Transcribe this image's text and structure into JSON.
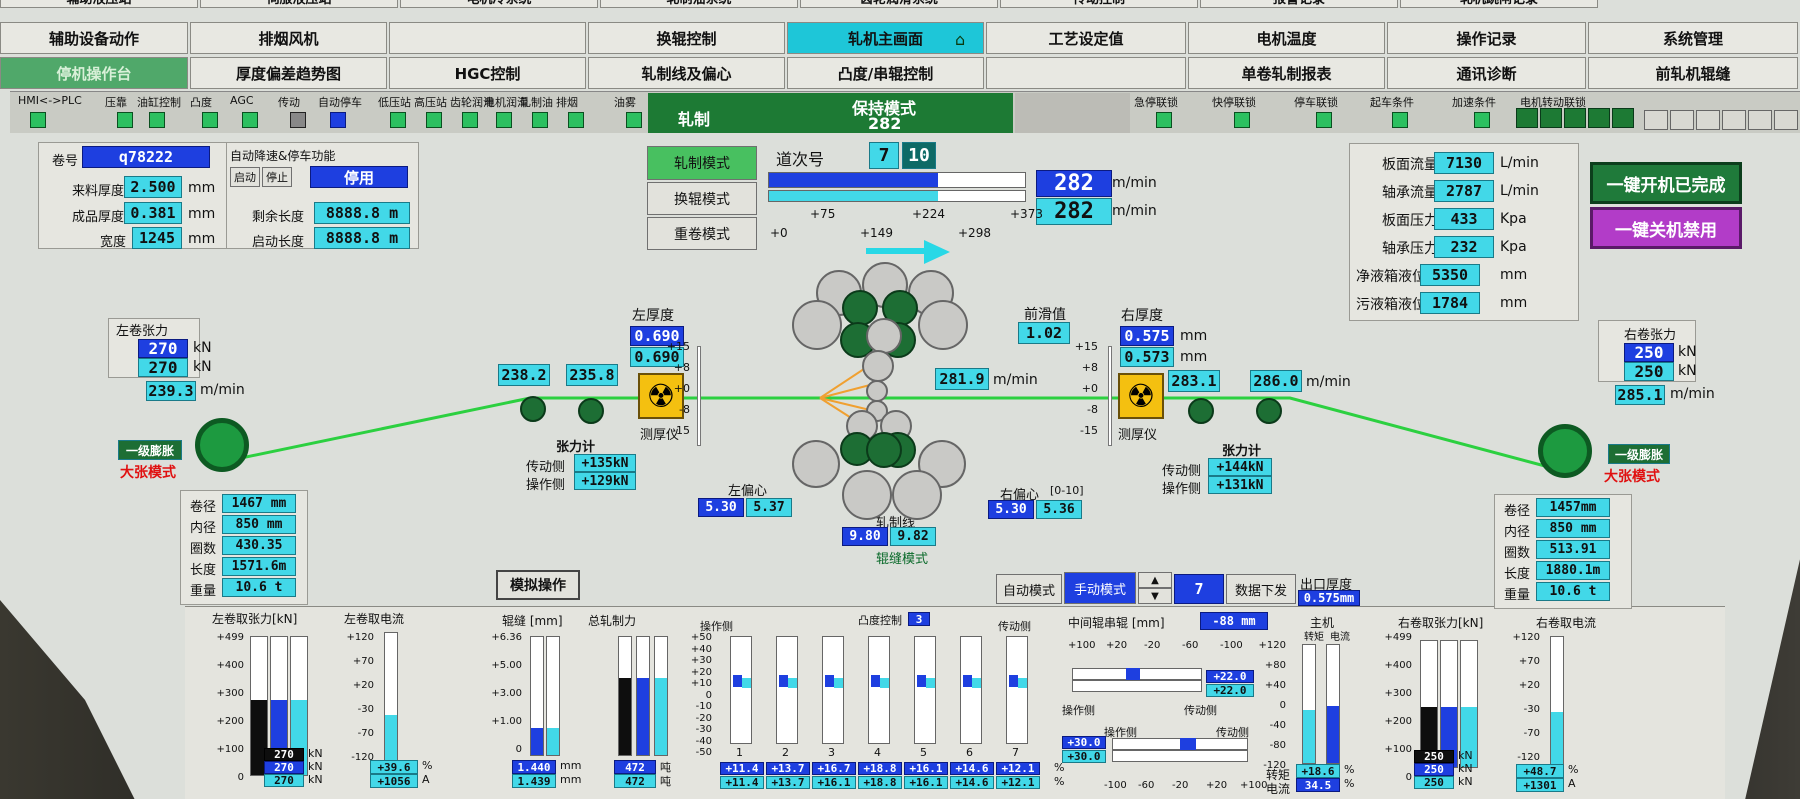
{
  "nav": {
    "row0": [
      "辅助液压站",
      "伺服液压站",
      "电机冷系统",
      "轧制油系统",
      "齿轮润滑系统",
      "传动控制",
      "报警记录",
      "轧机跳闸记录"
    ],
    "row1": [
      "辅助设备动作",
      "排烟风机",
      "",
      "换辊控制",
      "轧机主画面",
      "工艺设定值",
      "电机温度",
      "操作记录",
      "系统管理"
    ],
    "row2": [
      "停机操作台",
      "厚度偏差趋势图",
      "HGC控制",
      "轧制线及偏心",
      "凸度/串辊控制",
      "",
      "单卷轧制报表",
      "通讯诊断",
      "前轧机辊缝"
    ]
  },
  "status": {
    "labels": [
      "HMI<->PLC",
      "压靠",
      "油缸控制",
      "凸度",
      "AGC",
      "传动",
      "自动停车",
      "低压站",
      "高压站",
      "齿轮润滑",
      "电机润滑",
      "轧制油",
      "排烟",
      "油雾"
    ],
    "rolling": "轧制",
    "mode_title": "保持模式",
    "mode_value": "282",
    "right_labels": [
      "急停联锁",
      "快停联锁",
      "停车联锁",
      "起车条件",
      "加速条件",
      "电机转动联锁"
    ]
  },
  "coil": {
    "no_label": "卷号",
    "no": "q78222",
    "in_thick_label": "来料厚度",
    "in_thick": "2.500",
    "out_thick_label": "成品厚度",
    "out_thick": "0.381",
    "width_label": "宽度",
    "width": "1245",
    "unit_mm": "mm",
    "auto_label": "自动降速&停车功能",
    "start": "启动",
    "stop": "停止",
    "state": "停用",
    "remain_label": "剩余长度",
    "remain": "8888.8 m",
    "startlen_label": "启动长度",
    "startlen": "8888.8 m"
  },
  "modes": {
    "rolling": "轧制模式",
    "roll_change": "换辊模式",
    "rewind": "重卷模式"
  },
  "pass": {
    "label": "道次号",
    "cur": "7",
    "total": "10"
  },
  "speed": {
    "v1": "282",
    "v2": "282",
    "unit": "m/min",
    "ticks": [
      "+75",
      "+224",
      "+373"
    ],
    "ticks2": [
      "+0",
      "+149",
      "+298"
    ]
  },
  "right_params": [
    {
      "l": "板面流量",
      "v": "7130",
      "u": "L/min"
    },
    {
      "l": "轴承流量",
      "v": "2787",
      "u": "L/min"
    },
    {
      "l": "板面压力",
      "v": "433",
      "u": "Kpa"
    },
    {
      "l": "轴承压力",
      "v": "232",
      "u": "Kpa"
    },
    {
      "l": "净液箱液位",
      "v": "5350",
      "u": "mm"
    },
    {
      "l": "污液箱液位",
      "v": "1784",
      "u": "mm"
    }
  ],
  "one_key": {
    "on": "一键开机已完成",
    "off": "一键关机禁用"
  },
  "left_tension": {
    "title": "左卷张力",
    "v1": "270",
    "v2": "270",
    "u": "kN",
    "speed": "239.3",
    "su": "m/min"
  },
  "right_tension": {
    "title": "右卷张力",
    "v1": "250",
    "v2": "250",
    "u": "kN",
    "speed": "285.1",
    "su": "m/min"
  },
  "left_thick": {
    "title": "左厚度",
    "v1": "0.690",
    "v2": "0.690",
    "gauge": "测厚仪",
    "ticks": [
      "+15",
      "+8",
      "+0",
      "-8",
      "-15"
    ]
  },
  "right_thick": {
    "title": "右厚度",
    "v1": "0.575",
    "v2": "0.573",
    "u": "mm",
    "gauge": "测厚仪"
  },
  "slip": {
    "label": "前滑值",
    "v": "1.02"
  },
  "line": {
    "lv1": "238.2",
    "lv2": "235.8",
    "mid": "281.9",
    "mu": "m/min",
    "rv1": "283.1",
    "rv2": "286.0",
    "ru": "m/min"
  },
  "left_tm": {
    "title": "张力计",
    "drive_l": "传动侧",
    "drive": "+135kN",
    "op_l": "操作侧",
    "op": "+129kN"
  },
  "right_tm": {
    "title": "张力计",
    "drive_l": "传动侧",
    "drive": "+144kN",
    "op_l": "操作侧",
    "op": "+131kN"
  },
  "ecc": {
    "left": "左偏心",
    "l1": "5.30",
    "l2": "5.37",
    "right": "右偏心",
    "range": "[0-10]",
    "r1": "5.30",
    "r2": "5.36",
    "line": "轧制线",
    "ln1": "9.80",
    "ln2": "9.82",
    "gap": "辊缝模式"
  },
  "left_coil": {
    "mode1": "一级膨胀",
    "mode2": "大张模式",
    "rows": [
      {
        "l": "卷径",
        "v": "1467 mm"
      },
      {
        "l": "内径",
        "v": "850 mm"
      },
      {
        "l": "圈数",
        "v": "430.35"
      },
      {
        "l": "长度",
        "v": "1571.6m"
      },
      {
        "l": "重量",
        "v": "10.6 t"
      }
    ]
  },
  "right_coil": {
    "mode1": "一级膨胀",
    "mode2": "大张模式",
    "rows": [
      {
        "l": "卷径",
        "v": "1457mm"
      },
      {
        "l": "内径",
        "v": "850 mm"
      },
      {
        "l": "圈数",
        "v": "513.91"
      },
      {
        "l": "长度",
        "v": "1880.1m"
      },
      {
        "l": "重量",
        "v": "10.6 t"
      }
    ]
  },
  "sim_btn": "模拟操作",
  "ctrl": {
    "auto": "自动模式",
    "manual": "手动模式",
    "num": "7",
    "send": "数据下发",
    "exit_label": "出口厚度",
    "exit": "0.575mm"
  },
  "bottom": {
    "lt": {
      "title": "左卷取张力[kN]",
      "ticks": [
        "+499",
        "+400",
        "+300",
        "+200",
        "+100",
        "0"
      ],
      "v": [
        "270",
        "270",
        "270"
      ],
      "u": "kN"
    },
    "lc": {
      "title": "左卷取电流",
      "ticks": [
        "+120",
        "+70",
        "+20",
        "-30",
        "-70",
        "-120"
      ],
      "v1": "+39.6",
      "u1": "%",
      "v2": "+1056",
      "u2": "A"
    },
    "gap": {
      "title": "辊缝 [mm]",
      "ticks": [
        "+6.36",
        "+5.00",
        "+3.00",
        "+1.00",
        "0"
      ],
      "v1": "1.440",
      "v2": "1.439",
      "u": "mm"
    },
    "force": {
      "title": "总轧制力",
      "v1": "472",
      "v2": "472",
      "u": "吨"
    },
    "crown": {
      "op": "操作侧",
      "title": "凸度控制",
      "n": "3",
      "drv": "传动侧",
      "ticks": [
        "+50",
        "+40",
        "+30",
        "+20",
        "+10",
        "0",
        "-10",
        "-20",
        "-30",
        "-40",
        "-50"
      ],
      "idx": [
        "1",
        "2",
        "3",
        "4",
        "5",
        "6",
        "7"
      ],
      "r1": [
        "+11.4",
        "+13.7",
        "+16.7",
        "+18.8",
        "+16.1",
        "+14.6",
        "+12.1"
      ],
      "r2": [
        "+11.4",
        "+13.7",
        "+16.1",
        "+18.8",
        "+16.1",
        "+14.6",
        "+12.1"
      ],
      "u": "%"
    },
    "shift": {
      "title": "中间辊串辊 [mm]",
      "v": "-88 mm",
      "ticks": [
        "+100",
        "+20",
        "-20",
        "-60",
        "-100"
      ],
      "op": "操作侧",
      "drv": "传动侧",
      "a1": "+22.0",
      "a2": "+22.0",
      "b1": "+30.0",
      "b2": "+30.0",
      "ticks2": [
        "-100",
        "-60",
        "-20",
        "+20",
        "+100"
      ]
    },
    "main": {
      "title": "主机",
      "t": "转矩",
      "c": "电流",
      "ticks": [
        "+120",
        "+80",
        "+40",
        "0",
        "-40",
        "-80",
        "-120"
      ],
      "tv": "+18.6",
      "tu": "%",
      "cv": "34.5",
      "cu": "%",
      "tl": "转矩",
      "cl": "电流"
    },
    "rt": {
      "title": "右卷取张力[kN]",
      "ticks": [
        "+499",
        "+400",
        "+300",
        "+200",
        "+100",
        "0"
      ],
      "v": [
        "250",
        "250",
        "250"
      ],
      "u": "kN"
    },
    "rc": {
      "title": "右卷取电流",
      "ticks": [
        "+120",
        "+70",
        "+20",
        "-30",
        "-70",
        "-120"
      ],
      "v1": "+48.7",
      "u1": "%",
      "v2": "+1301",
      "u2": "A"
    }
  }
}
